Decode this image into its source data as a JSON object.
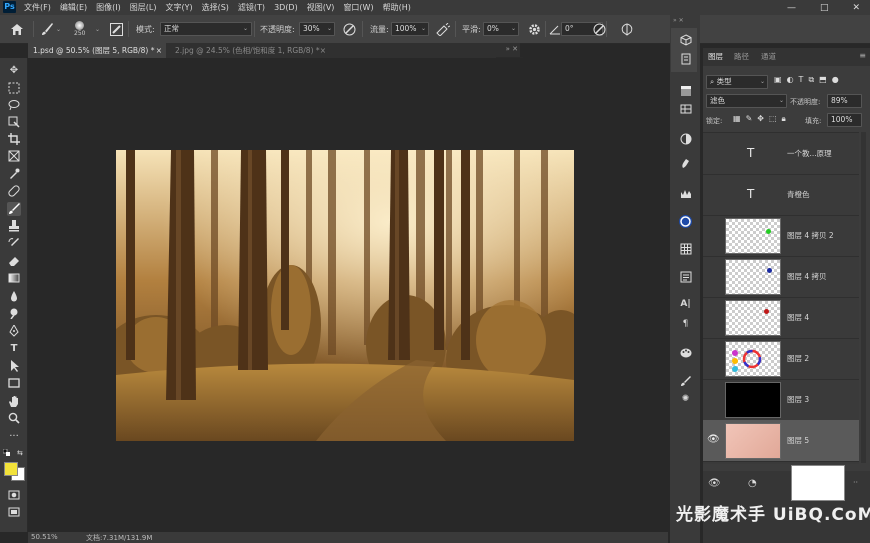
{
  "menubar": {
    "app_icon": "Ps",
    "items": [
      "文件(F)",
      "编辑(E)",
      "图像(I)",
      "图层(L)",
      "文字(Y)",
      "选择(S)",
      "滤镜(T)",
      "3D(D)",
      "视图(V)",
      "窗口(W)",
      "帮助(H)"
    ],
    "controls": [
      "—",
      "□",
      "✕"
    ]
  },
  "options": {
    "brush_size": "250",
    "mode_label": "模式:",
    "mode_value": "正常",
    "opacity_label": "不透明度:",
    "opacity_value": "30%",
    "flow_label": "流量:",
    "flow_value": "100%",
    "smoothing_label": "平滑:",
    "smoothing_value": "0%",
    "angle_value": "0°"
  },
  "tabs": [
    {
      "label": "1.psd @ 50.5% (图层 5, RGB/8) *",
      "close": "×"
    },
    {
      "label": "2.jpg @ 24.5% (色相/饱和度 1, RGB/8) *",
      "close": "×"
    }
  ],
  "status": {
    "zoom": "50.51%",
    "doc": "文档:7.31M/131.9M"
  },
  "layers_panel": {
    "tabs": [
      "图层",
      "路径",
      "通道"
    ],
    "filter_kind": "类型",
    "blend_mode": "滤色",
    "opacity_label": "不透明度:",
    "opacity_value": "89%",
    "lock_label": "锁定:",
    "fill_label": "填充:",
    "fill_value": "100%",
    "layers": [
      {
        "name": "一个教...原理",
        "type": "text",
        "glyph": "T"
      },
      {
        "name": "青橙色",
        "type": "text",
        "glyph": "T"
      },
      {
        "name": "图层 4 拷贝 2",
        "type": "dot",
        "dot_color": "#22cc22"
      },
      {
        "name": "图层 4 拷贝",
        "type": "dot",
        "dot_color": "#1a2aa0"
      },
      {
        "name": "图层 4",
        "type": "dot",
        "dot_color": "#c01818"
      },
      {
        "name": "图层 2",
        "type": "palette"
      },
      {
        "name": "图层 3",
        "type": "black"
      },
      {
        "name": "图层 5",
        "type": "pink",
        "selected": true
      }
    ]
  },
  "watermark": "光影魔术手 UiBQ.CoM",
  "colors": {
    "foreground": "#f2e23a",
    "background": "#ffffff",
    "accent": "#31a8ff"
  }
}
